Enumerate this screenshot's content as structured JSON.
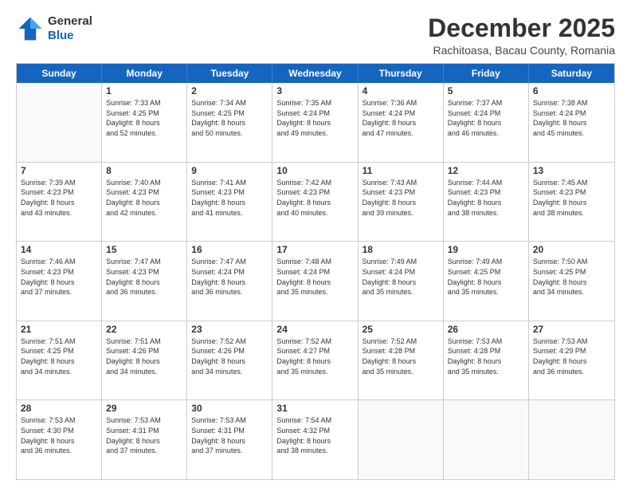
{
  "logo": {
    "general": "General",
    "blue": "Blue"
  },
  "header": {
    "title": "December 2025",
    "subtitle": "Rachitoasa, Bacau County, Romania"
  },
  "days": [
    "Sunday",
    "Monday",
    "Tuesday",
    "Wednesday",
    "Thursday",
    "Friday",
    "Saturday"
  ],
  "weeks": [
    [
      {
        "day": "",
        "lines": []
      },
      {
        "day": "1",
        "lines": [
          "Sunrise: 7:33 AM",
          "Sunset: 4:25 PM",
          "Daylight: 8 hours",
          "and 52 minutes."
        ]
      },
      {
        "day": "2",
        "lines": [
          "Sunrise: 7:34 AM",
          "Sunset: 4:25 PM",
          "Daylight: 8 hours",
          "and 50 minutes."
        ]
      },
      {
        "day": "3",
        "lines": [
          "Sunrise: 7:35 AM",
          "Sunset: 4:24 PM",
          "Daylight: 8 hours",
          "and 49 minutes."
        ]
      },
      {
        "day": "4",
        "lines": [
          "Sunrise: 7:36 AM",
          "Sunset: 4:24 PM",
          "Daylight: 8 hours",
          "and 47 minutes."
        ]
      },
      {
        "day": "5",
        "lines": [
          "Sunrise: 7:37 AM",
          "Sunset: 4:24 PM",
          "Daylight: 8 hours",
          "and 46 minutes."
        ]
      },
      {
        "day": "6",
        "lines": [
          "Sunrise: 7:38 AM",
          "Sunset: 4:24 PM",
          "Daylight: 8 hours",
          "and 45 minutes."
        ]
      }
    ],
    [
      {
        "day": "7",
        "lines": [
          "Sunrise: 7:39 AM",
          "Sunset: 4:23 PM",
          "Daylight: 8 hours",
          "and 43 minutes."
        ]
      },
      {
        "day": "8",
        "lines": [
          "Sunrise: 7:40 AM",
          "Sunset: 4:23 PM",
          "Daylight: 8 hours",
          "and 42 minutes."
        ]
      },
      {
        "day": "9",
        "lines": [
          "Sunrise: 7:41 AM",
          "Sunset: 4:23 PM",
          "Daylight: 8 hours",
          "and 41 minutes."
        ]
      },
      {
        "day": "10",
        "lines": [
          "Sunrise: 7:42 AM",
          "Sunset: 4:23 PM",
          "Daylight: 8 hours",
          "and 40 minutes."
        ]
      },
      {
        "day": "11",
        "lines": [
          "Sunrise: 7:43 AM",
          "Sunset: 4:23 PM",
          "Daylight: 8 hours",
          "and 39 minutes."
        ]
      },
      {
        "day": "12",
        "lines": [
          "Sunrise: 7:44 AM",
          "Sunset: 4:23 PM",
          "Daylight: 8 hours",
          "and 38 minutes."
        ]
      },
      {
        "day": "13",
        "lines": [
          "Sunrise: 7:45 AM",
          "Sunset: 4:23 PM",
          "Daylight: 8 hours",
          "and 38 minutes."
        ]
      }
    ],
    [
      {
        "day": "14",
        "lines": [
          "Sunrise: 7:46 AM",
          "Sunset: 4:23 PM",
          "Daylight: 8 hours",
          "and 37 minutes."
        ]
      },
      {
        "day": "15",
        "lines": [
          "Sunrise: 7:47 AM",
          "Sunset: 4:23 PM",
          "Daylight: 8 hours",
          "and 36 minutes."
        ]
      },
      {
        "day": "16",
        "lines": [
          "Sunrise: 7:47 AM",
          "Sunset: 4:24 PM",
          "Daylight: 8 hours",
          "and 36 minutes."
        ]
      },
      {
        "day": "17",
        "lines": [
          "Sunrise: 7:48 AM",
          "Sunset: 4:24 PM",
          "Daylight: 8 hours",
          "and 35 minutes."
        ]
      },
      {
        "day": "18",
        "lines": [
          "Sunrise: 7:49 AM",
          "Sunset: 4:24 PM",
          "Daylight: 8 hours",
          "and 35 minutes."
        ]
      },
      {
        "day": "19",
        "lines": [
          "Sunrise: 7:49 AM",
          "Sunset: 4:25 PM",
          "Daylight: 8 hours",
          "and 35 minutes."
        ]
      },
      {
        "day": "20",
        "lines": [
          "Sunrise: 7:50 AM",
          "Sunset: 4:25 PM",
          "Daylight: 8 hours",
          "and 34 minutes."
        ]
      }
    ],
    [
      {
        "day": "21",
        "lines": [
          "Sunrise: 7:51 AM",
          "Sunset: 4:25 PM",
          "Daylight: 8 hours",
          "and 34 minutes."
        ]
      },
      {
        "day": "22",
        "lines": [
          "Sunrise: 7:51 AM",
          "Sunset: 4:26 PM",
          "Daylight: 8 hours",
          "and 34 minutes."
        ]
      },
      {
        "day": "23",
        "lines": [
          "Sunrise: 7:52 AM",
          "Sunset: 4:26 PM",
          "Daylight: 8 hours",
          "and 34 minutes."
        ]
      },
      {
        "day": "24",
        "lines": [
          "Sunrise: 7:52 AM",
          "Sunset: 4:27 PM",
          "Daylight: 8 hours",
          "and 35 minutes."
        ]
      },
      {
        "day": "25",
        "lines": [
          "Sunrise: 7:52 AM",
          "Sunset: 4:28 PM",
          "Daylight: 8 hours",
          "and 35 minutes."
        ]
      },
      {
        "day": "26",
        "lines": [
          "Sunrise: 7:53 AM",
          "Sunset: 4:28 PM",
          "Daylight: 8 hours",
          "and 35 minutes."
        ]
      },
      {
        "day": "27",
        "lines": [
          "Sunrise: 7:53 AM",
          "Sunset: 4:29 PM",
          "Daylight: 8 hours",
          "and 36 minutes."
        ]
      }
    ],
    [
      {
        "day": "28",
        "lines": [
          "Sunrise: 7:53 AM",
          "Sunset: 4:30 PM",
          "Daylight: 8 hours",
          "and 36 minutes."
        ]
      },
      {
        "day": "29",
        "lines": [
          "Sunrise: 7:53 AM",
          "Sunset: 4:31 PM",
          "Daylight: 8 hours",
          "and 37 minutes."
        ]
      },
      {
        "day": "30",
        "lines": [
          "Sunrise: 7:53 AM",
          "Sunset: 4:31 PM",
          "Daylight: 8 hours",
          "and 37 minutes."
        ]
      },
      {
        "day": "31",
        "lines": [
          "Sunrise: 7:54 AM",
          "Sunset: 4:32 PM",
          "Daylight: 8 hours",
          "and 38 minutes."
        ]
      },
      {
        "day": "",
        "lines": []
      },
      {
        "day": "",
        "lines": []
      },
      {
        "day": "",
        "lines": []
      }
    ]
  ]
}
